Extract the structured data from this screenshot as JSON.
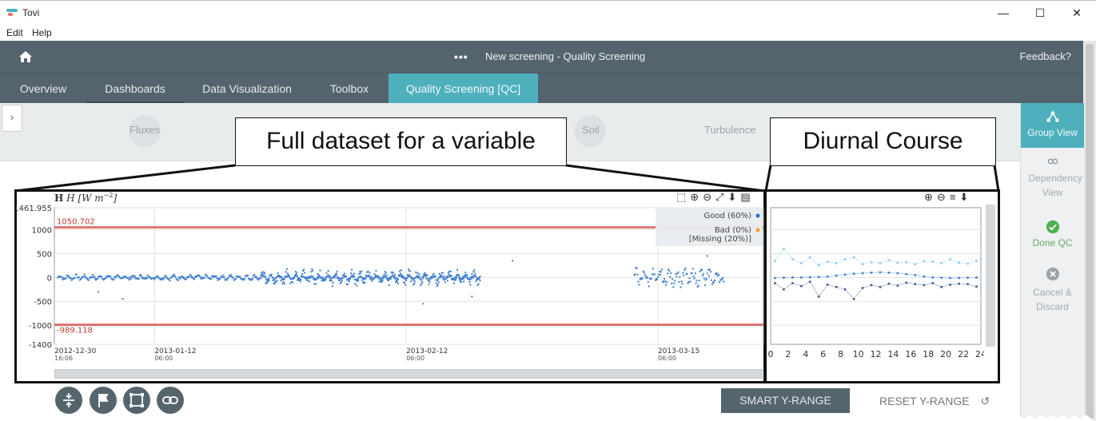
{
  "window": {
    "title": "Tovi",
    "minimize": "—",
    "maximize": "☐",
    "close": "✕"
  },
  "menu": [
    "Edit",
    "Help"
  ],
  "header": {
    "more": "•••",
    "title": "New screening - Quality Screening",
    "feedback": "Feedback?"
  },
  "tabs": [
    "Overview",
    "Dashboards",
    "Data Visualization",
    "Toolbox",
    "Quality Screening [QC]"
  ],
  "categories": [
    "Fluxes",
    "Soil",
    "Turbulence"
  ],
  "sidebar": {
    "group_view": "Group View",
    "dependency_view": "Dependency View",
    "done_qc": "Done QC",
    "cancel_discard": "Cancel & Discard"
  },
  "callouts": {
    "left": "Full dataset for a variable",
    "right": "Diurnal Course"
  },
  "buttons": {
    "smart_y_range": "SMART Y-RANGE",
    "reset_y_range": "RESET Y-RANGE"
  },
  "colors": {
    "header": "#54646e",
    "accent": "#4fb0bd",
    "series": "#3f7fd0",
    "threshold": "#d9534f",
    "diurnal_light": "#8ccaf0"
  },
  "chart_data": [
    {
      "type": "scatter",
      "title": "",
      "ylabel": "H [W m⁻²]",
      "ylabel_text": "H [W m",
      "ylabel_sup": "−2",
      "ylim": [
        -1400,
        1461.955
      ],
      "y_ticks": [
        "1461.955",
        "1000",
        "500",
        "0",
        "-500",
        "-1000",
        "-1400"
      ],
      "x_ticks": [
        {
          "date": "2012-12-30",
          "time": "16:06"
        },
        {
          "date": "2013-01-12",
          "time": "06:00"
        },
        {
          "date": "2013-02-12",
          "time": "06:00"
        },
        {
          "date": "2013-03-15",
          "time": "06:00"
        }
      ],
      "thresholds": [
        {
          "value": 1050.702,
          "label": "1050.702"
        },
        {
          "value": -989.118,
          "label": "-989.118"
        }
      ],
      "legend": [
        "Good (60%)",
        "Bad (0%)",
        "[Missing (20%)]"
      ],
      "legend_position": "top-right",
      "series": [
        {
          "name": "Good (60%)",
          "color": "#3f7fd0",
          "segments": [
            {
              "start": "2012-12-31",
              "end": "2013-02-21",
              "amp": 60
            },
            {
              "start": "2013-01-25",
              "end": "2013-02-21",
              "amp": 170
            },
            {
              "start": "2013-03-12",
              "end": "2013-03-23",
              "amp": 200
            }
          ]
        }
      ]
    },
    {
      "type": "scatter",
      "title": "",
      "x_ticks": [
        "0",
        "2",
        "4",
        "6",
        "8",
        "10",
        "12",
        "14",
        "16",
        "18",
        "20",
        "22",
        "24"
      ],
      "xlim": [
        0,
        24
      ],
      "ylim": [
        -1400,
        1461.955
      ],
      "series": [
        {
          "name": "",
          "color": "#8ccaf0",
          "values": [
            350,
            600,
            380,
            300,
            420,
            260,
            330,
            300,
            380,
            420,
            280,
            320,
            300,
            360,
            310,
            320,
            280,
            340,
            330,
            300,
            380,
            310,
            290,
            350
          ]
        },
        {
          "name": "",
          "color": "#3f7fd0",
          "values": [
            -10,
            -5,
            0,
            0,
            5,
            10,
            20,
            40,
            60,
            80,
            90,
            100,
            110,
            100,
            90,
            70,
            50,
            20,
            0,
            -5,
            -10,
            -10,
            -5,
            0
          ]
        },
        {
          "name": "",
          "color": "#3f5f90",
          "values": [
            -120,
            -250,
            -120,
            -180,
            -90,
            -400,
            -150,
            -200,
            -250,
            -450,
            -220,
            -160,
            -200,
            -130,
            -170,
            -110,
            -140,
            -160,
            -120,
            -200,
            -150,
            -130,
            -140,
            -190
          ]
        }
      ]
    }
  ]
}
